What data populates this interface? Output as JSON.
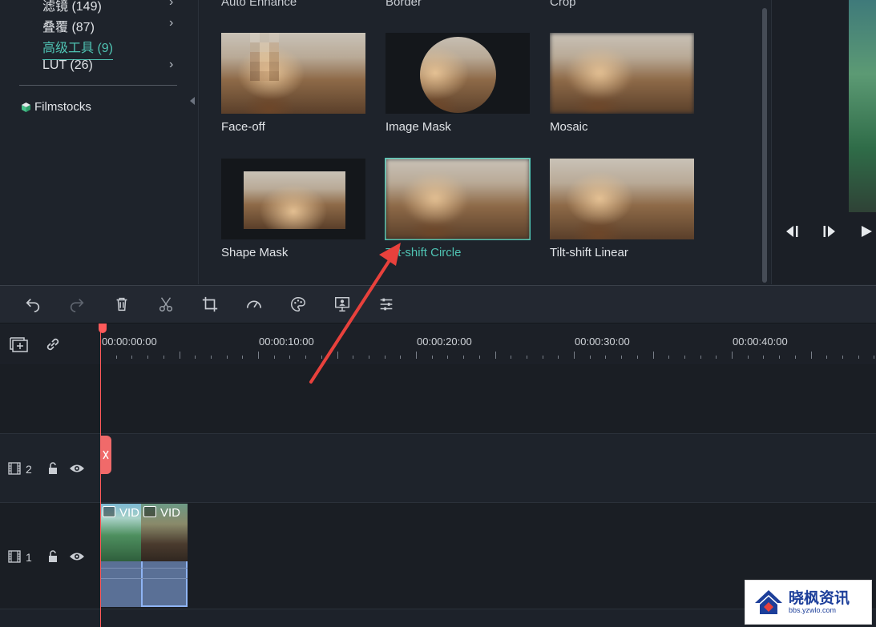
{
  "sidebar": {
    "categories": [
      {
        "label": "滤镜 (149)"
      },
      {
        "label": "叠覆 (87)"
      },
      {
        "label": "高级工具 (9)"
      },
      {
        "label": "LUT (26)"
      }
    ],
    "filmstocks_label": "Filmstocks"
  },
  "effects": {
    "top_row": [
      "Auto Enhance",
      "Border",
      "Crop"
    ],
    "items": [
      {
        "label": "Face-off"
      },
      {
        "label": "Image Mask"
      },
      {
        "label": "Mosaic"
      },
      {
        "label": "Shape Mask"
      },
      {
        "label": "Tilt-shift Circle",
        "selected": true
      },
      {
        "label": "Tilt-shift Linear"
      }
    ]
  },
  "timeline": {
    "timecodes": [
      "00:00:00:00",
      "00:00:10:00",
      "00:00:20:00",
      "00:00:30:00",
      "00:00:40:00"
    ],
    "tracks": [
      {
        "number": "2"
      },
      {
        "number": "1"
      }
    ],
    "clips": [
      {
        "label": "VID"
      },
      {
        "label": "VID"
      }
    ]
  },
  "watermark": {
    "title": "晓枫资讯",
    "url": "bbs.yzwlo.com"
  },
  "colors": {
    "accent": "#4fc3b3",
    "playhead": "#ff5a5a",
    "annotation_arrow": "#e8413c"
  }
}
